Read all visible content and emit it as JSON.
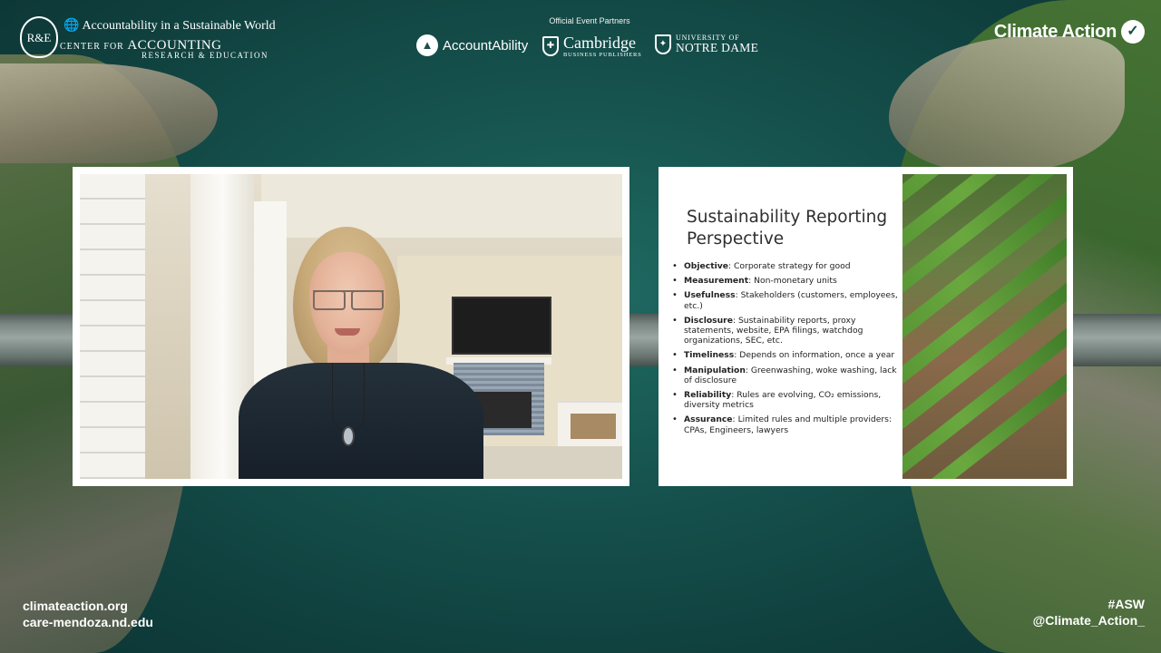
{
  "header": {
    "care": {
      "emblem": "R&E",
      "line1": "Accountability in a Sustainable World",
      "line2_prefix": "CENTER FOR",
      "line2_big": "ACCOUNTING",
      "line3": "RESEARCH & EDUCATION"
    },
    "partners_label": "Official Event Partners",
    "partners": {
      "accountability": "AccountAbility",
      "cambridge_name": "Cambridge",
      "cambridge_sub": "BUSINESS PUBLISHERS",
      "notre_dame_line1": "UNIVERSITY OF",
      "notre_dame_line2": "NOTRE DAME"
    },
    "brand": "Climate Action"
  },
  "slide": {
    "title": "Sustainability Reporting Perspective",
    "bullets": [
      {
        "term": "Objective",
        "text": ": Corporate strategy for good"
      },
      {
        "term": "Measurement",
        "text": ": Non-monetary units"
      },
      {
        "term": "Usefulness",
        "text": ": Stakeholders (customers, employees, etc.)"
      },
      {
        "term": "Disclosure",
        "text": ": Sustainability reports, proxy statements, website, EPA filings, watchdog organizations, SEC, etc."
      },
      {
        "term": "Timeliness",
        "text": ": Depends on information, once a year"
      },
      {
        "term": "Manipulation",
        "text": ": Greenwashing, woke washing, lack of disclosure"
      },
      {
        "term": "Reliability",
        "text": ": Rules are evolving, CO₂ emissions, diversity metrics"
      },
      {
        "term": "Assurance",
        "text": ": Limited rules and multiple providers: CPAs, Engineers, lawyers"
      }
    ]
  },
  "footer": {
    "url1": "climateaction.org",
    "url2": "care-mendoza.nd.edu",
    "hashtag": "#ASW",
    "handle": "@Climate_Action_"
  },
  "colors": {
    "background": "#154f4b",
    "panel": "#ffffff",
    "text_on_bg": "#ffffff"
  },
  "icons": {
    "accountability": "accountability-logo-icon",
    "cambridge": "cambridge-shield-icon",
    "notre_dame": "notre-dame-shield-icon",
    "climate_action": "climate-action-logo-icon"
  }
}
